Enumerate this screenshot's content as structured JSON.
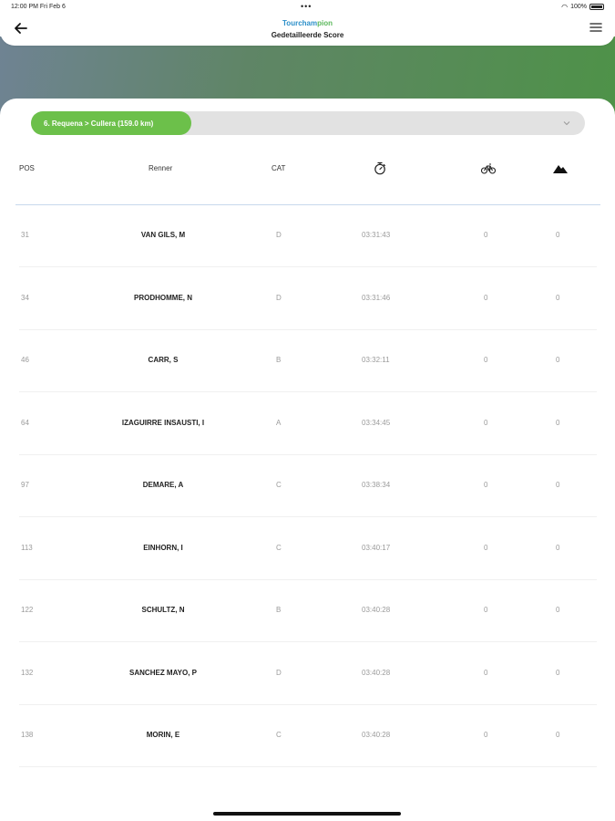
{
  "status_bar": {
    "time": "12:00 PM   Fri Feb 6",
    "dots": "•••",
    "battery": "100%"
  },
  "header": {
    "logo_main": "Tourcham",
    "logo_accent": "pion",
    "title": "Gedetailleerde Score"
  },
  "stage": {
    "label": "6. Requena > Cullera (159.0 km)"
  },
  "columns": {
    "pos": "POS",
    "rider": "Renner",
    "cat": "CAT"
  },
  "icons": {
    "back": "back-arrow-icon",
    "menu": "hamburger-menu-icon",
    "time": "stopwatch-icon",
    "bike": "bicycle-icon",
    "mountain": "mountain-icon"
  },
  "rows": [
    {
      "pos": "31",
      "name": "VAN GILS, M",
      "cat": "D",
      "time": "03:31:43",
      "bike": "0",
      "mountain": "0"
    },
    {
      "pos": "34",
      "name": "PRODHOMME, N",
      "cat": "D",
      "time": "03:31:46",
      "bike": "0",
      "mountain": "0"
    },
    {
      "pos": "46",
      "name": "CARR, S",
      "cat": "B",
      "time": "03:32:11",
      "bike": "0",
      "mountain": "0"
    },
    {
      "pos": "64",
      "name": "IZAGUIRRE INSAUSTI, I",
      "cat": "A",
      "time": "03:34:45",
      "bike": "0",
      "mountain": "0"
    },
    {
      "pos": "97",
      "name": "DEMARE, A",
      "cat": "C",
      "time": "03:38:34",
      "bike": "0",
      "mountain": "0"
    },
    {
      "pos": "113",
      "name": "EINHORN, I",
      "cat": "C",
      "time": "03:40:17",
      "bike": "0",
      "mountain": "0"
    },
    {
      "pos": "122",
      "name": "SCHULTZ, N",
      "cat": "B",
      "time": "03:40:28",
      "bike": "0",
      "mountain": "0"
    },
    {
      "pos": "132",
      "name": "SANCHEZ MAYO, P",
      "cat": "D",
      "time": "03:40:28",
      "bike": "0",
      "mountain": "0"
    },
    {
      "pos": "138",
      "name": "MORIN, E",
      "cat": "C",
      "time": "03:40:28",
      "bike": "0",
      "mountain": "0"
    }
  ]
}
